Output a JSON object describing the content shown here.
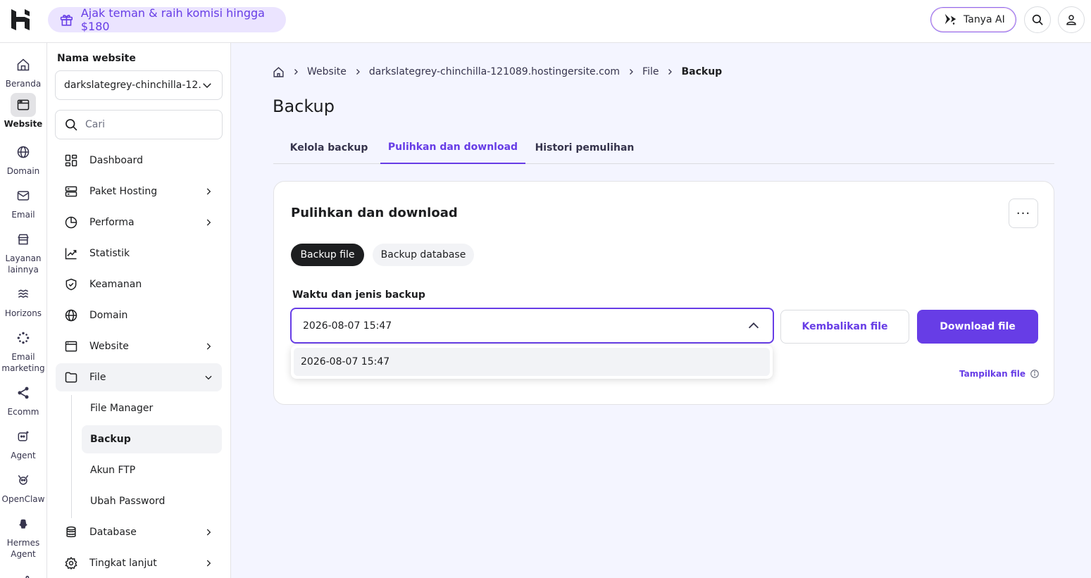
{
  "topbar": {
    "promo_text": "Ajak teman & raih komisi hingga $180",
    "ask_ai_label": "Tanya AI"
  },
  "rail": {
    "items": [
      {
        "label": "Beranda",
        "icon": "home-icon"
      },
      {
        "label": "Website",
        "icon": "website-icon",
        "active": true
      },
      {
        "label": "Domain",
        "icon": "globe-icon"
      },
      {
        "label": "Email",
        "icon": "mail-icon"
      },
      {
        "label": "Layanan lainnya",
        "icon": "store-icon"
      },
      {
        "label": "Horizons",
        "icon": "horizons-icon"
      },
      {
        "label": "Email marketing",
        "icon": "email-marketing-icon"
      },
      {
        "label": "Ecomm",
        "icon": "ecomm-icon"
      },
      {
        "label": "Agent",
        "icon": "agent-icon"
      },
      {
        "label": "OpenClaw",
        "icon": "openclaw-icon"
      },
      {
        "label": "Hermes Agent",
        "icon": "hermes-icon"
      }
    ]
  },
  "sidebar": {
    "title": "Nama website",
    "site_selected": "darkslategrey-chinchilla-12…",
    "search_placeholder": "Cari",
    "items": [
      {
        "label": "Dashboard"
      },
      {
        "label": "Paket Hosting"
      },
      {
        "label": "Performa"
      },
      {
        "label": "Statistik"
      },
      {
        "label": "Keamanan"
      },
      {
        "label": "Domain"
      },
      {
        "label": "Website"
      },
      {
        "label": "File"
      },
      {
        "label": "Database"
      },
      {
        "label": "Tingkat lanjut"
      }
    ],
    "file_sub": [
      {
        "label": "File Manager"
      },
      {
        "label": "Backup"
      },
      {
        "label": "Akun FTP"
      },
      {
        "label": "Ubah Password"
      }
    ]
  },
  "breadcrumb": [
    "Website",
    "darkslategrey-chinchilla-121089.hostingersite.com",
    "File",
    "Backup"
  ],
  "page": {
    "title": "Backup",
    "tabs": [
      "Kelola backup",
      "Pulihkan dan download",
      "Histori pemulihan"
    ],
    "active_tab": "Pulihkan dan download"
  },
  "card": {
    "title": "Pulihkan dan download",
    "more_label": "···",
    "pills": [
      "Backup file",
      "Backup database"
    ],
    "field_label": "Waktu dan jenis backup",
    "selected_value": "2026-08-07 15:47",
    "options": [
      "2026-08-07 15:47"
    ],
    "restore_label": "Kembalikan file",
    "download_label": "Download file",
    "show_files_label": "Tampilkan file"
  },
  "colors": {
    "accent": "#673de6",
    "promo_bg": "#ebe4ff",
    "dark_pill": "#1d1e20"
  }
}
